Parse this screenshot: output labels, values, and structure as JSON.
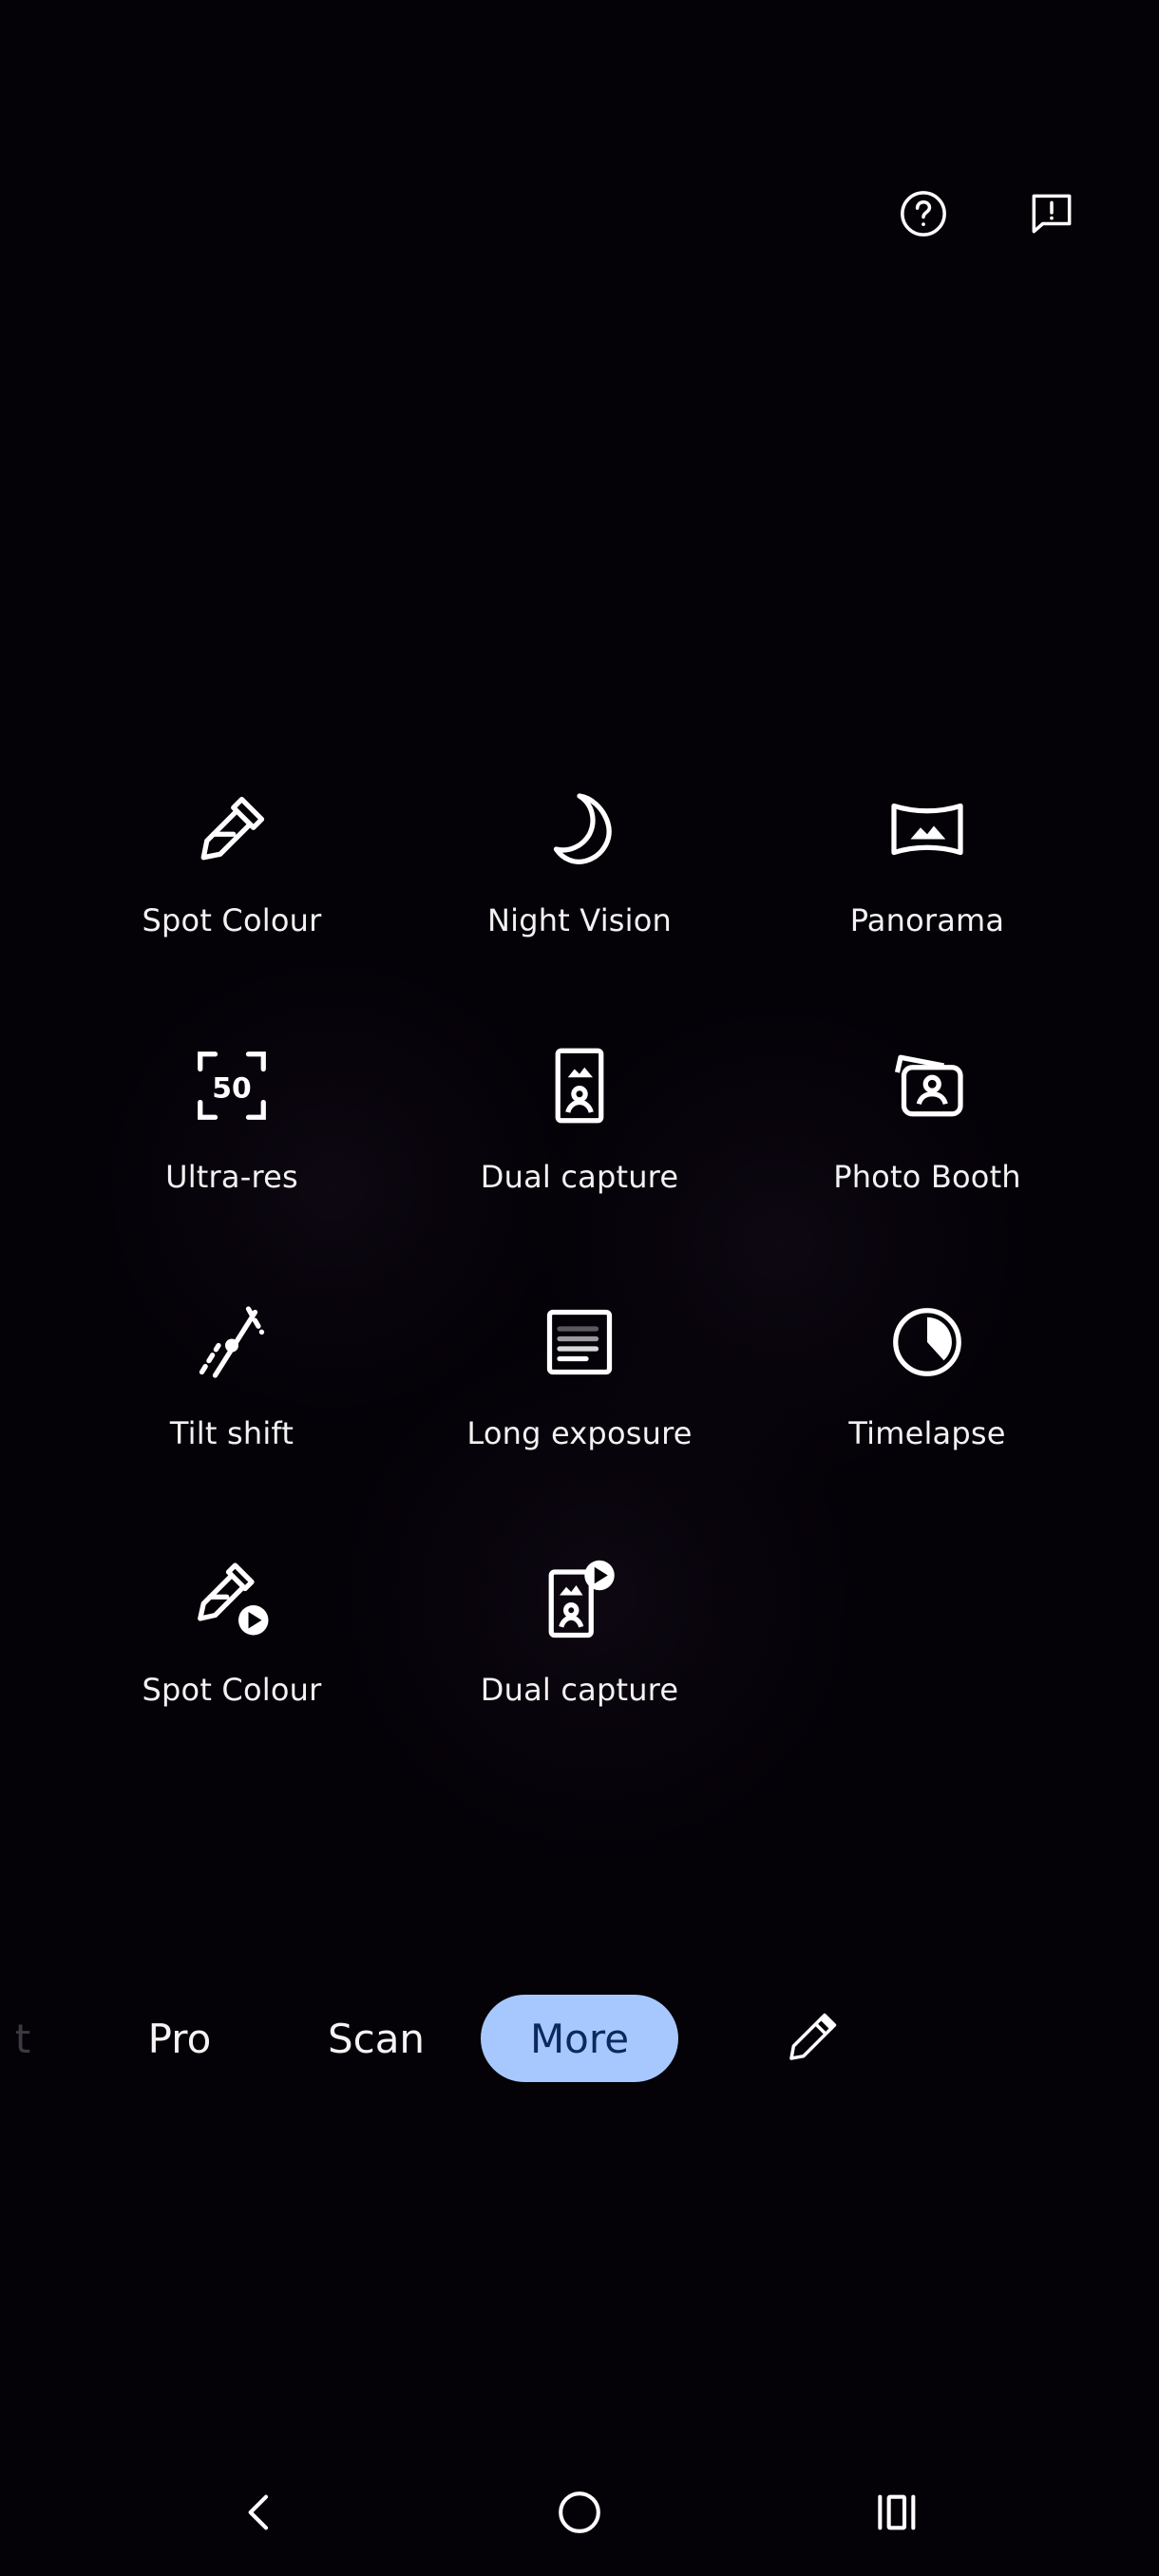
{
  "top_bar": {
    "help_icon": "help-circle-icon",
    "feedback_icon": "feedback-icon"
  },
  "modes": [
    {
      "label": "Spot Colour",
      "icon": "eyedropper-icon"
    },
    {
      "label": "Night Vision",
      "icon": "moon-icon"
    },
    {
      "label": "Panorama",
      "icon": "panorama-icon"
    },
    {
      "label": "Ultra-res",
      "icon": "ultra-res-50-icon"
    },
    {
      "label": "Dual capture",
      "icon": "dual-capture-icon"
    },
    {
      "label": "Photo Booth",
      "icon": "photo-booth-icon"
    },
    {
      "label": "Tilt shift",
      "icon": "tilt-shift-icon"
    },
    {
      "label": "Long exposure",
      "icon": "long-exposure-icon"
    },
    {
      "label": "Timelapse",
      "icon": "timelapse-icon"
    },
    {
      "label": "Spot Colour",
      "icon": "eyedropper-video-icon"
    },
    {
      "label": "Dual capture",
      "icon": "dual-capture-video-icon"
    }
  ],
  "mode_bar": {
    "partial_label": "t",
    "tabs": [
      "Pro",
      "Scan",
      "More"
    ],
    "active": "More",
    "edit_icon": "pencil-icon"
  },
  "colors": {
    "background": "#040107",
    "active_tab_bg": "#a7c8ff",
    "active_tab_text": "#0b2a5c"
  },
  "nav": {
    "back_icon": "back-chevron-icon",
    "home_icon": "home-circle-icon",
    "recents_icon": "recents-icon"
  }
}
